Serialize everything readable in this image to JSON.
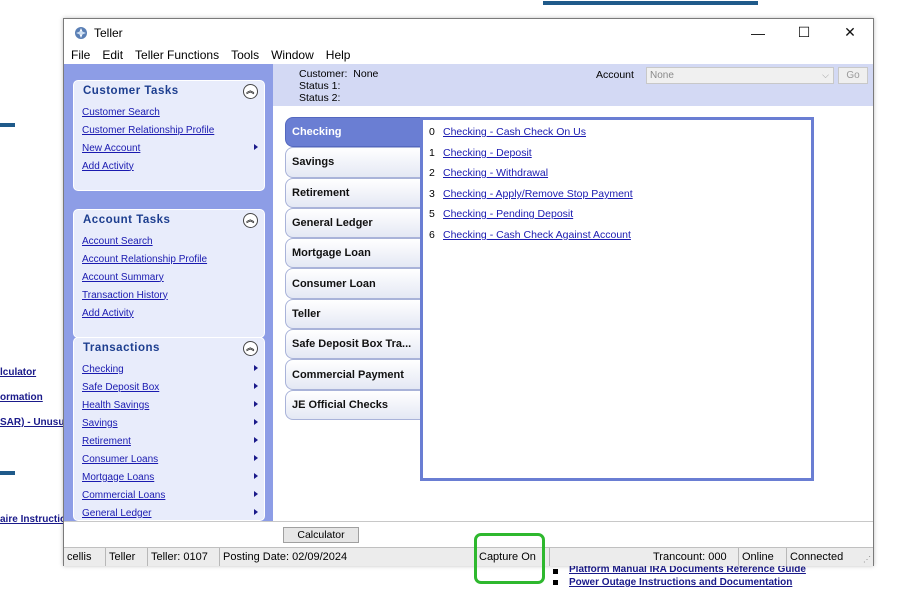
{
  "background": {
    "left_links": [
      "lculator",
      "ormation",
      "SAR) - Unusu",
      "aire Instructio"
    ],
    "bottom_links": [
      "Platform Manual IRA Documents Reference Guide",
      "Power Outage Instructions and Documentation"
    ]
  },
  "window": {
    "title": "Teller",
    "controls": {
      "minimize": "—",
      "maximize": "☐",
      "close": "✕"
    },
    "menu": [
      "File",
      "Edit",
      "Teller Functions",
      "Tools",
      "Window",
      "Help"
    ]
  },
  "customer_tasks": {
    "title": "Customer Tasks",
    "items": [
      {
        "label": "Customer Search",
        "submenu": false
      },
      {
        "label": "Customer Relationship Profile",
        "submenu": false
      },
      {
        "label": "New Account",
        "submenu": true
      },
      {
        "label": "Add Activity",
        "submenu": false
      }
    ]
  },
  "account_tasks": {
    "title": "Account Tasks",
    "items": [
      {
        "label": "Account Search",
        "submenu": false
      },
      {
        "label": "Account Relationship Profile",
        "submenu": false
      },
      {
        "label": "Account Summary",
        "submenu": false
      },
      {
        "label": "Transaction History",
        "submenu": false
      },
      {
        "label": "Add Activity",
        "submenu": false
      }
    ]
  },
  "transactions": {
    "title": "Transactions",
    "items": [
      {
        "label": "Checking",
        "submenu": true
      },
      {
        "label": "Safe Deposit Box",
        "submenu": true
      },
      {
        "label": "Health Savings",
        "submenu": true
      },
      {
        "label": "Savings",
        "submenu": true
      },
      {
        "label": "Retirement",
        "submenu": true
      },
      {
        "label": "Consumer Loans",
        "submenu": true
      },
      {
        "label": "Mortgage Loans",
        "submenu": true
      },
      {
        "label": "Commercial Loans",
        "submenu": true
      },
      {
        "label": "General Ledger",
        "submenu": true
      }
    ]
  },
  "info": {
    "customer_label": "Customer:",
    "customer_value": "None",
    "status1_label": "Status 1:",
    "status2_label": "Status 2:",
    "account_label": "Account",
    "account_value": "None",
    "go_label": "Go"
  },
  "tabs": [
    {
      "label": "Checking",
      "active": true
    },
    {
      "label": "Savings",
      "active": false
    },
    {
      "label": "Retirement",
      "active": false
    },
    {
      "label": "General Ledger",
      "active": false
    },
    {
      "label": "Mortgage Loan",
      "active": false
    },
    {
      "label": "Consumer Loan",
      "active": false
    },
    {
      "label": "Teller",
      "active": false
    },
    {
      "label": "Safe Deposit Box Tra...",
      "active": false
    },
    {
      "label": "Commercial Payment",
      "active": false
    },
    {
      "label": "JE Official Checks",
      "active": false
    }
  ],
  "transactions_list": [
    {
      "num": "0",
      "label": "Checking - Cash Check On Us"
    },
    {
      "num": "1",
      "label": "Checking - Deposit"
    },
    {
      "num": "2",
      "label": "Checking - Withdrawal"
    },
    {
      "num": "3",
      "label": "Checking - Apply/Remove Stop Payment"
    },
    {
      "num": "5",
      "label": "Checking - Pending Deposit"
    },
    {
      "num": "6",
      "label": "Checking - Cash Check Against Account"
    }
  ],
  "calculator_label": "Calculator",
  "status_bar": {
    "user": "cellis",
    "role": "Teller",
    "teller": "Teller: 0107",
    "posting_date": "Posting Date: 02/09/2024",
    "capture": "Capture On",
    "trancount": "Trancount: 000",
    "online": "Online",
    "connected": "Connected"
  },
  "colors": {
    "left_panel": "#8d9de6",
    "header_band": "#d3d9f4",
    "active_tab": "#6a7ed3",
    "link": "#1a1ab0",
    "highlight": "#2eb82e"
  }
}
